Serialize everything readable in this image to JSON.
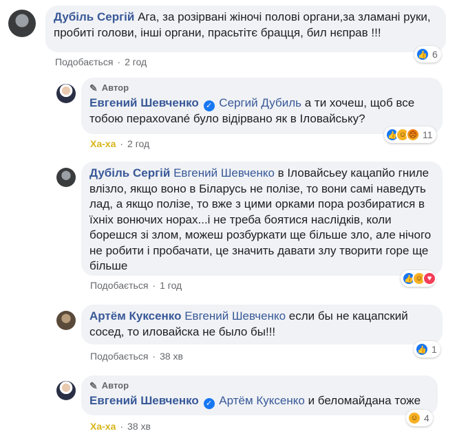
{
  "comments": [
    {
      "author": "Дубіль Сергій",
      "tag": "",
      "text": "Ага, за розірвані жіночі полові органи,за зламані руки, пробиті голови, інші органи, прасьтітє брацця, бил нєправ !!!",
      "action": "Подобається",
      "time": "2 год",
      "reaction_count": "6"
    },
    {
      "author_badge": "Автор",
      "author": "Евгений Шевченко",
      "tag": "Сергий Дубиль",
      "text": "а ти хочеш, щоб все тобою перахované було відірвано як в Іловайську?",
      "action": "Ха-ха",
      "time": "2 год",
      "reaction_count": "11"
    },
    {
      "author": "Дубіль Сергій",
      "tag": "Евгений Шевченко",
      "text": "в Іловайсьеу кацапйо гниле влізло, якщо воно в Біларусь не полізе, то вони самі наведуть лад, а якщо полізе, то вже з цими орками пора розбиратися в їхніх вонючих норах...і не треба боятися наслідків, коли борешся зі злом, можеш розбуркати ще більше зло, але нічого не робити і пробачати, це значить давати злу творити горе ще більше",
      "action": "Подобається",
      "time": "1 год",
      "reaction_count": ""
    },
    {
      "author": "Артём Куксенко",
      "tag": "Евгений Шевченко",
      "text": "если бы не кацапский сосед, то иловайска не было бы!!!",
      "action": "Подобається",
      "time": "38 хв",
      "reaction_count": "1"
    },
    {
      "author_badge": "Автор",
      "author": "Евгений Шевченко",
      "tag": "Артём Куксенко",
      "text": "и беломайдана тоже",
      "action": "Ха-ха",
      "time": "38 хв",
      "reaction_count": "4"
    }
  ],
  "dot": "·",
  "colors": {
    "link": "#385898",
    "bubble": "#f0f2f5",
    "haha": "#d7b51a",
    "like": "#1877f2"
  }
}
